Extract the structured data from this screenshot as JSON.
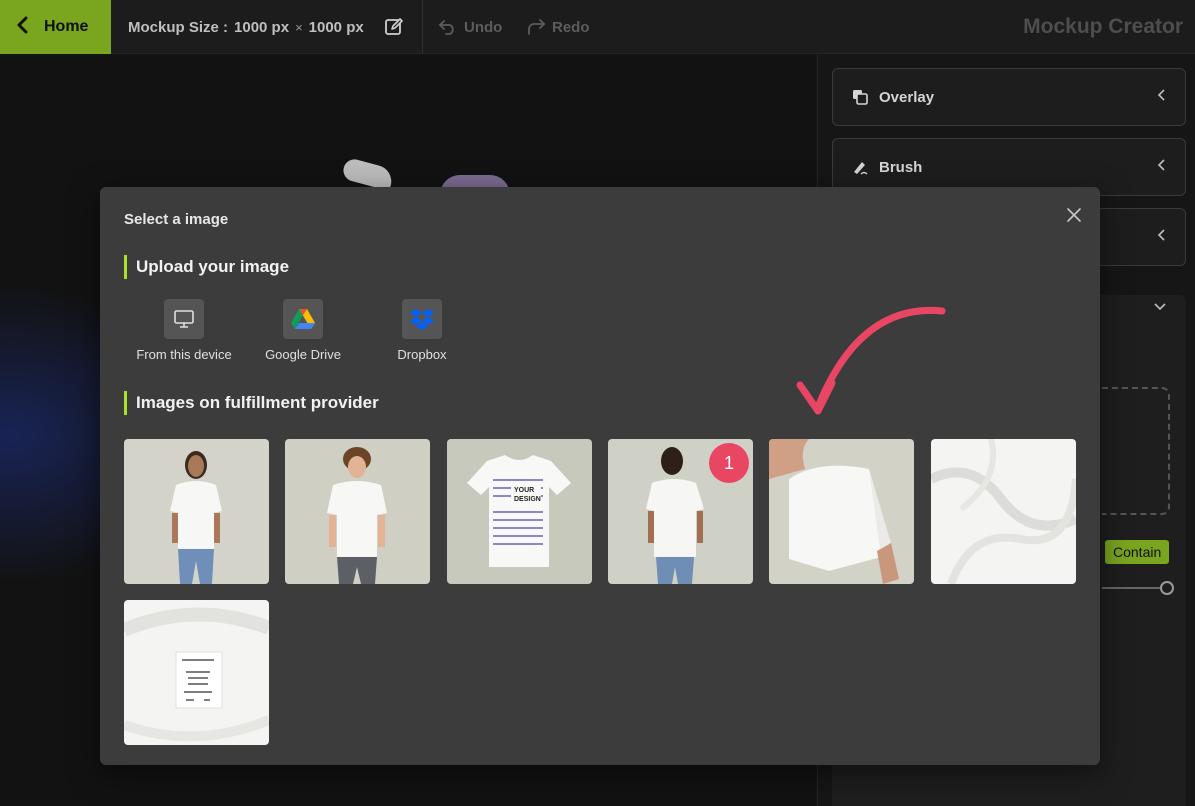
{
  "topbar": {
    "home_label": "Home",
    "mockup_size_label": "Mockup Size :",
    "width": "1000 px",
    "times": "×",
    "height": "1000 px",
    "undo_label": "Undo",
    "redo_label": "Redo",
    "app_title": "Mockup Creator"
  },
  "right_panel": {
    "items": [
      {
        "label": "Overlay",
        "icon": "layers-icon"
      },
      {
        "label": "Brush",
        "icon": "brush-icon"
      },
      {
        "label": "",
        "icon": ""
      }
    ],
    "contain_label": "Contain"
  },
  "modal": {
    "title": "Select a image",
    "upload_heading": "Upload your image",
    "upload_options": [
      {
        "label": "From this device",
        "icon": "monitor-icon"
      },
      {
        "label": "Google Drive",
        "icon": "google-drive-icon"
      },
      {
        "label": "Dropbox",
        "icon": "dropbox-icon"
      }
    ],
    "provider_heading": "Images on fulfillment provider",
    "images": [
      {
        "subject": "woman-front-white-tshirt"
      },
      {
        "subject": "man-front-white-tshirt"
      },
      {
        "subject": "flat-tshirt-your-design",
        "text_line1": "YOUR",
        "text_line2": "DESIGN"
      },
      {
        "subject": "woman-back-white-tshirt"
      },
      {
        "subject": "sleeve-closeup"
      },
      {
        "subject": "fabric-texture"
      },
      {
        "subject": "neck-label-closeup"
      }
    ],
    "annotation_badge": "1"
  },
  "colors": {
    "accent": "#7aa51e",
    "heading_bar": "#a6e22e",
    "badge": "#e94663",
    "modal_bg": "#3c3c3c"
  }
}
